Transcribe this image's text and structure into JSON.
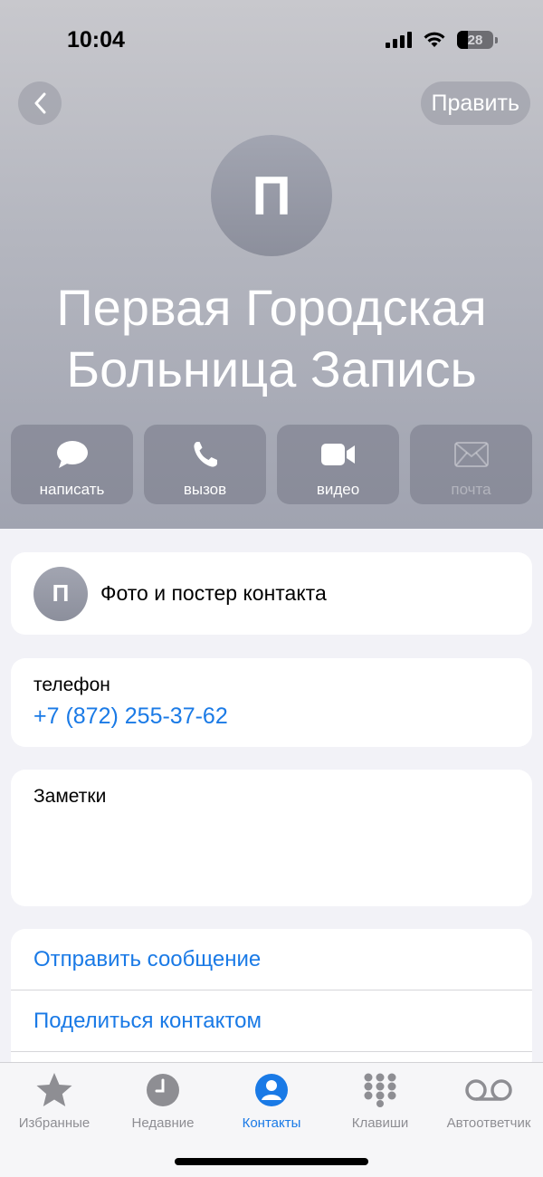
{
  "status": {
    "time": "10:04",
    "battery": "28"
  },
  "nav": {
    "edit_label": "Править"
  },
  "contact": {
    "initial": "П",
    "name_line1": "Первая Городская",
    "name_line2": "Больница Запись"
  },
  "actions": [
    {
      "label": "написать",
      "icon": "message-icon"
    },
    {
      "label": "вызов",
      "icon": "phone-icon"
    },
    {
      "label": "видео",
      "icon": "video-icon"
    },
    {
      "label": "почта",
      "icon": "mail-icon",
      "disabled": true
    }
  ],
  "photo_card": {
    "initial": "П",
    "label": "Фото и постер контакта"
  },
  "phone_card": {
    "label": "телефон",
    "number": "+7 (872) 255-37-62"
  },
  "notes_card": {
    "label": "Заметки"
  },
  "links": {
    "send_message": "Отправить сообщение",
    "share_contact": "Поделиться контактом"
  },
  "tabs": [
    {
      "label": "Избранные",
      "icon": "star-icon"
    },
    {
      "label": "Недавние",
      "icon": "clock-icon"
    },
    {
      "label": "Контакты",
      "icon": "person-icon",
      "active": true
    },
    {
      "label": "Клавиши",
      "icon": "keypad-icon"
    },
    {
      "label": "Автоответчик",
      "icon": "voicemail-icon"
    }
  ],
  "colors": {
    "accent": "#1a7ae6",
    "background": "#f2f2f7",
    "header": "#b4b6bf"
  }
}
